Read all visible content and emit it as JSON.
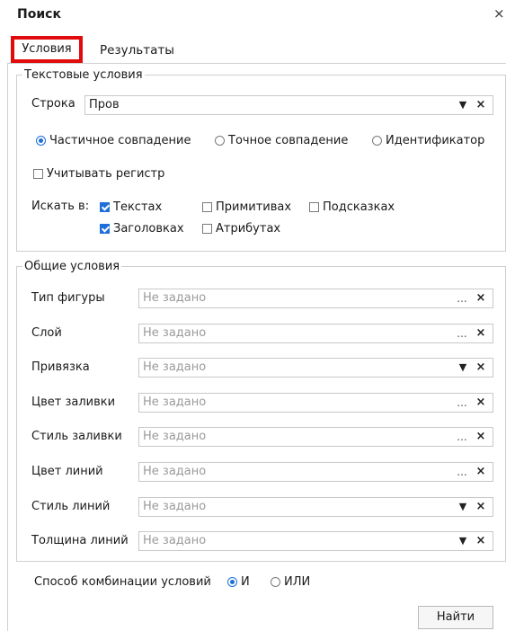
{
  "window": {
    "title": "Поиск",
    "close_glyph": "×"
  },
  "tabs": [
    {
      "label": "Условия",
      "active": true
    },
    {
      "label": "Результаты",
      "active": false
    }
  ],
  "text_conditions": {
    "legend": "Текстовые условия",
    "string_label": "Строка",
    "string_value": "Пров",
    "match_modes": [
      {
        "label": "Частичное совпадение",
        "selected": true
      },
      {
        "label": "Точное совпадение",
        "selected": false
      },
      {
        "label": "Идентификатор",
        "selected": false
      }
    ],
    "case_sensitive": {
      "label": "Учитывать регистр",
      "checked": false
    },
    "search_in_label": "Искать в:",
    "search_in": [
      {
        "label": "Текстах",
        "checked": true
      },
      {
        "label": "Примитивах",
        "checked": false
      },
      {
        "label": "Подсказках",
        "checked": false
      },
      {
        "label": "Заголовках",
        "checked": true
      },
      {
        "label": "Атрибутах",
        "checked": false
      }
    ]
  },
  "general_conditions": {
    "legend": "Общие условия",
    "placeholder": "Не задано",
    "fields": [
      {
        "label": "Тип фигуры",
        "button": "dots"
      },
      {
        "label": "Слой",
        "button": "dots"
      },
      {
        "label": "Привязка",
        "button": "arrow"
      },
      {
        "label": "Цвет заливки",
        "button": "dots"
      },
      {
        "label": "Стиль заливки",
        "button": "dots"
      },
      {
        "label": "Цвет линий",
        "button": "dots"
      },
      {
        "label": "Стиль линий",
        "button": "arrow"
      },
      {
        "label": "Толщина линий",
        "button": "arrow"
      }
    ]
  },
  "combination": {
    "label": "Способ комбинации условий",
    "options": [
      {
        "label": "И",
        "selected": true
      },
      {
        "label": "ИЛИ",
        "selected": false
      }
    ]
  },
  "actions": {
    "find_label": "Найти"
  },
  "glyphs": {
    "arrow": "▼",
    "dots": "...",
    "clear": "×"
  },
  "colors": {
    "accent": "#1e6fd9",
    "highlight": "#e20b0b"
  }
}
